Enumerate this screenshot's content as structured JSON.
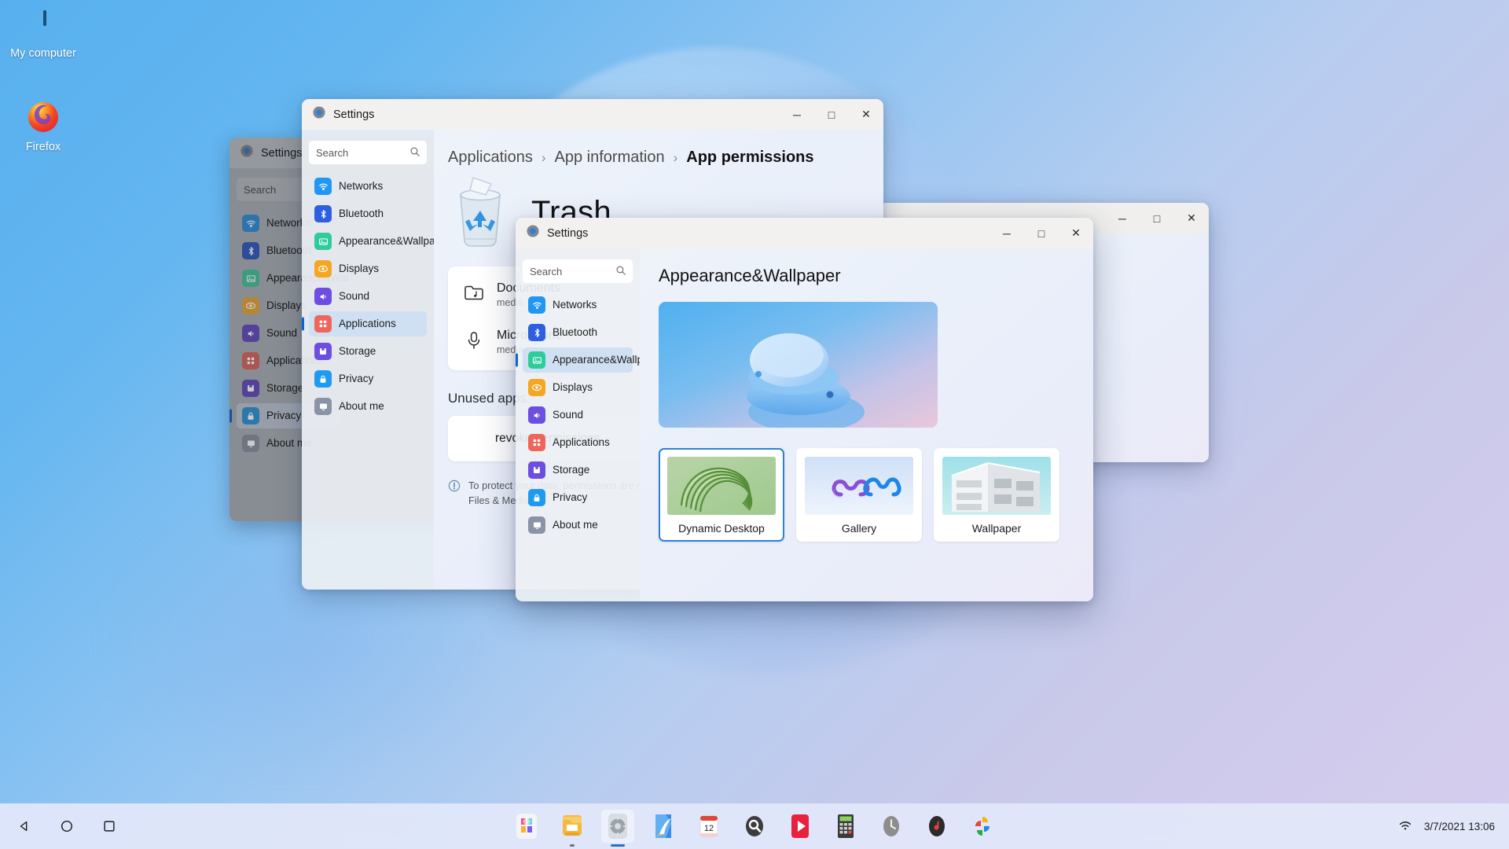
{
  "desktop": {
    "icons": [
      {
        "name": "My computer",
        "icon": "computer-icon"
      },
      {
        "name": "Firefox",
        "icon": "firefox-icon"
      }
    ]
  },
  "nav_items": [
    {
      "label": "Networks",
      "icon": "wifi-icon",
      "color": "#2196f3"
    },
    {
      "label": "Bluetooth",
      "icon": "bluetooth-icon",
      "color": "#2d5fe0"
    },
    {
      "label": "Appearance&Wallpaper",
      "icon": "image-icon",
      "color": "#2ecc9b"
    },
    {
      "label": "Displays",
      "icon": "eye-icon",
      "color": "#f5a623"
    },
    {
      "label": "Sound",
      "icon": "speaker-icon",
      "color": "#6c4ee0"
    },
    {
      "label": "Applications",
      "icon": "grid-icon",
      "color": "#f0655a"
    },
    {
      "label": "Storage",
      "icon": "floppy-icon",
      "color": "#6c4ee0"
    },
    {
      "label": "Privacy",
      "icon": "lock-icon",
      "color": "#1e9bf0"
    },
    {
      "label": "About me",
      "icon": "monitor-icon",
      "color": "#8a94a6"
    }
  ],
  "window_back": {
    "title": "Settings",
    "search_placeholder": "Search",
    "active_item": "Privacy"
  },
  "window_right": {
    "title": "",
    "buttons": {
      "minimize": "─",
      "maximize": "□",
      "close": "✕"
    }
  },
  "window_mid": {
    "title": "Settings",
    "search_placeholder": "Search",
    "active_item": "Applications",
    "buttons": {
      "minimize": "─",
      "maximize": "□",
      "close": "✕"
    },
    "breadcrumb": [
      "Applications",
      "App information",
      "App permissions"
    ],
    "breadcrumb_sep": "›",
    "app_name": "Trash",
    "permissions": [
      {
        "name": "Documents",
        "desc": "media",
        "icon": "folder-music-icon"
      },
      {
        "name": "Microphone",
        "desc": "media",
        "icon": "microphone-icon"
      }
    ],
    "unused_section_title": "Unused apps",
    "unused_action": "revoke permissions",
    "notice_line1": "To protect your data, permissions are revoked for unused apps:",
    "notice_line2": "Files & Media"
  },
  "window_front": {
    "title": "Settings",
    "search_placeholder": "Search",
    "active_item": "Appearance&Wallpaper",
    "buttons": {
      "minimize": "─",
      "maximize": "□",
      "close": "✕"
    },
    "page_title": "Appearance&Wallpaper",
    "tiles": [
      {
        "label": "Dynamic Desktop",
        "selected": true
      },
      {
        "label": "Gallery",
        "selected": false
      },
      {
        "label": "Wallpaper",
        "selected": false
      }
    ]
  },
  "taskbar": {
    "nav": [
      {
        "name": "back-button",
        "glyph": "◁"
      },
      {
        "name": "home-button",
        "glyph": "○"
      },
      {
        "name": "recents-button",
        "glyph": "□"
      }
    ],
    "apps": [
      {
        "name": "store-icon"
      },
      {
        "name": "files-icon"
      },
      {
        "name": "settings-icon"
      },
      {
        "name": "gallery-icon"
      },
      {
        "name": "calendar-icon",
        "label": "12"
      },
      {
        "name": "search-icon"
      },
      {
        "name": "video-player-icon"
      },
      {
        "name": "calculator-icon"
      },
      {
        "name": "clock-icon"
      },
      {
        "name": "music-icon"
      },
      {
        "name": "photos-icon"
      }
    ],
    "status": {
      "wifi": "wifi-icon",
      "datetime": "3/7/2021 13:06"
    }
  }
}
